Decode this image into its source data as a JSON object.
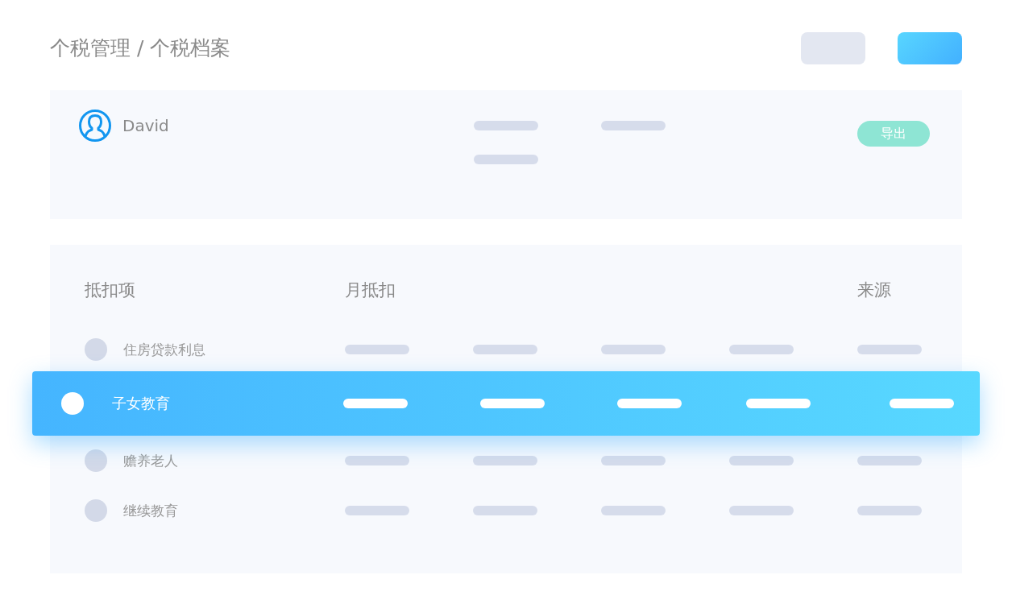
{
  "breadcrumb": "个税管理 / 个税档案",
  "header_buttons": [
    {
      "kind": "secondary"
    },
    {
      "kind": "primary"
    }
  ],
  "profile": {
    "name": "David",
    "export_button": "导出"
  },
  "deductions": {
    "columns": [
      "抵扣项",
      "月抵扣",
      "来源"
    ],
    "rows": [
      {
        "label": "住房贷款利息",
        "selected": false
      },
      {
        "label": "子女教育",
        "selected": true
      },
      {
        "label": "赡养老人",
        "selected": false
      },
      {
        "label": "继续教育",
        "selected": false
      }
    ]
  }
}
